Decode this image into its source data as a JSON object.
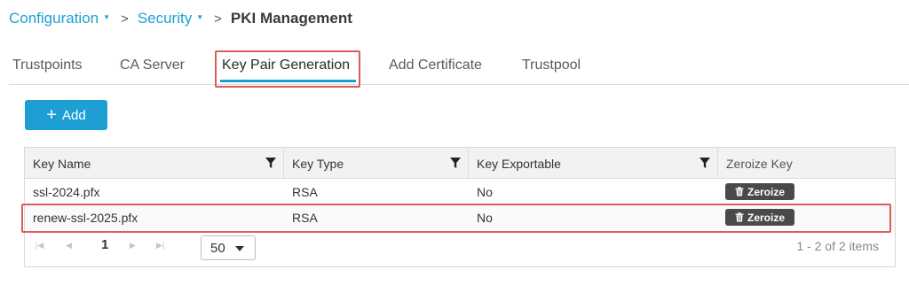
{
  "breadcrumb": {
    "configuration": "Configuration",
    "security": "Security",
    "current": "PKI Management",
    "separator": ">"
  },
  "tabs": [
    {
      "label": "Trustpoints",
      "active": false
    },
    {
      "label": "CA Server",
      "active": false
    },
    {
      "label": "Key Pair Generation",
      "active": true
    },
    {
      "label": "Add Certificate",
      "active": false
    },
    {
      "label": "Trustpool",
      "active": false
    }
  ],
  "toolbar": {
    "add_label": "Add",
    "add_icon": "plus-icon"
  },
  "table": {
    "columns": [
      {
        "label": "Key Name",
        "filterable": true
      },
      {
        "label": "Key Type",
        "filterable": true
      },
      {
        "label": "Key Exportable",
        "filterable": true
      },
      {
        "label": "Zeroize Key",
        "filterable": false
      }
    ],
    "rows": [
      {
        "key_name": "ssl-2024.pfx",
        "key_type": "RSA",
        "exportable": "No",
        "action": "Zeroize"
      },
      {
        "key_name": "renew-ssl-2025.pfx",
        "key_type": "RSA",
        "exportable": "No",
        "action": "Zeroize"
      }
    ]
  },
  "pagination": {
    "current_page": "1",
    "page_size": "50",
    "range_text": "1 - 2 of 2 items"
  },
  "colors": {
    "accent": "#1e9fd4",
    "highlight": "#e05a5a",
    "zeroize_bg": "#4a4a4a"
  }
}
